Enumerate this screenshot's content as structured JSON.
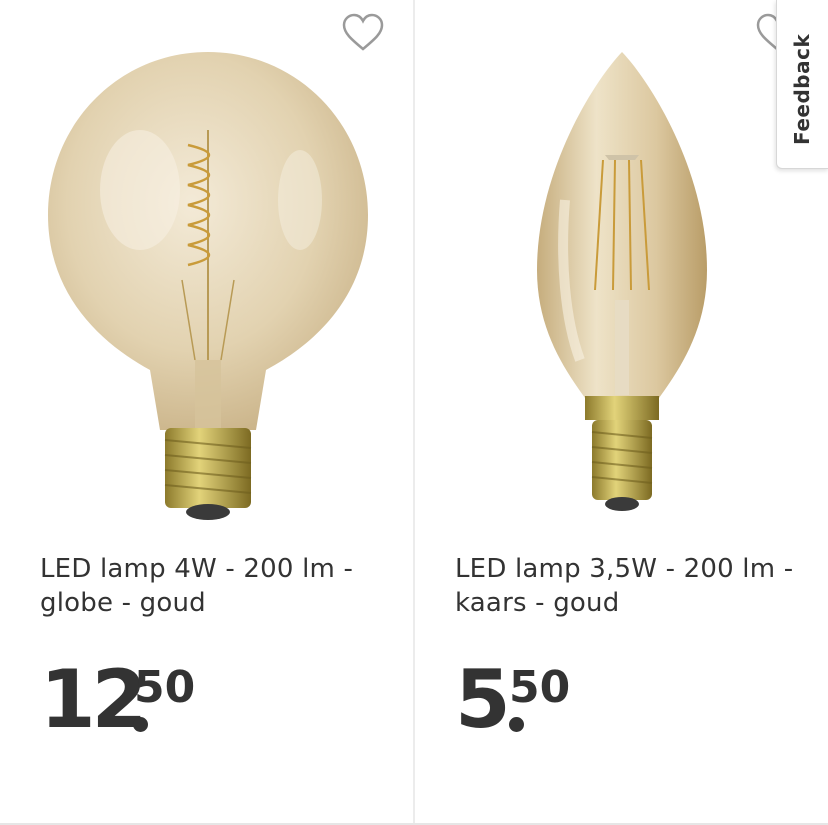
{
  "products": [
    {
      "title_line1": "LED lamp 4W - 200 lm -",
      "title_line2": "globe - goud",
      "price_whole": "12",
      "price_fraction": "50"
    },
    {
      "title_line1": "LED lamp 3,5W - 200 lm -",
      "title_line2": "kaars - goud",
      "price_whole": "5",
      "price_fraction": "50"
    }
  ],
  "feedback_tab": {
    "label": "Feedback"
  },
  "colors": {
    "text": "#333333",
    "divider": "#ececec",
    "glass": "#d9c7a3",
    "brass": "#b7a24a"
  }
}
